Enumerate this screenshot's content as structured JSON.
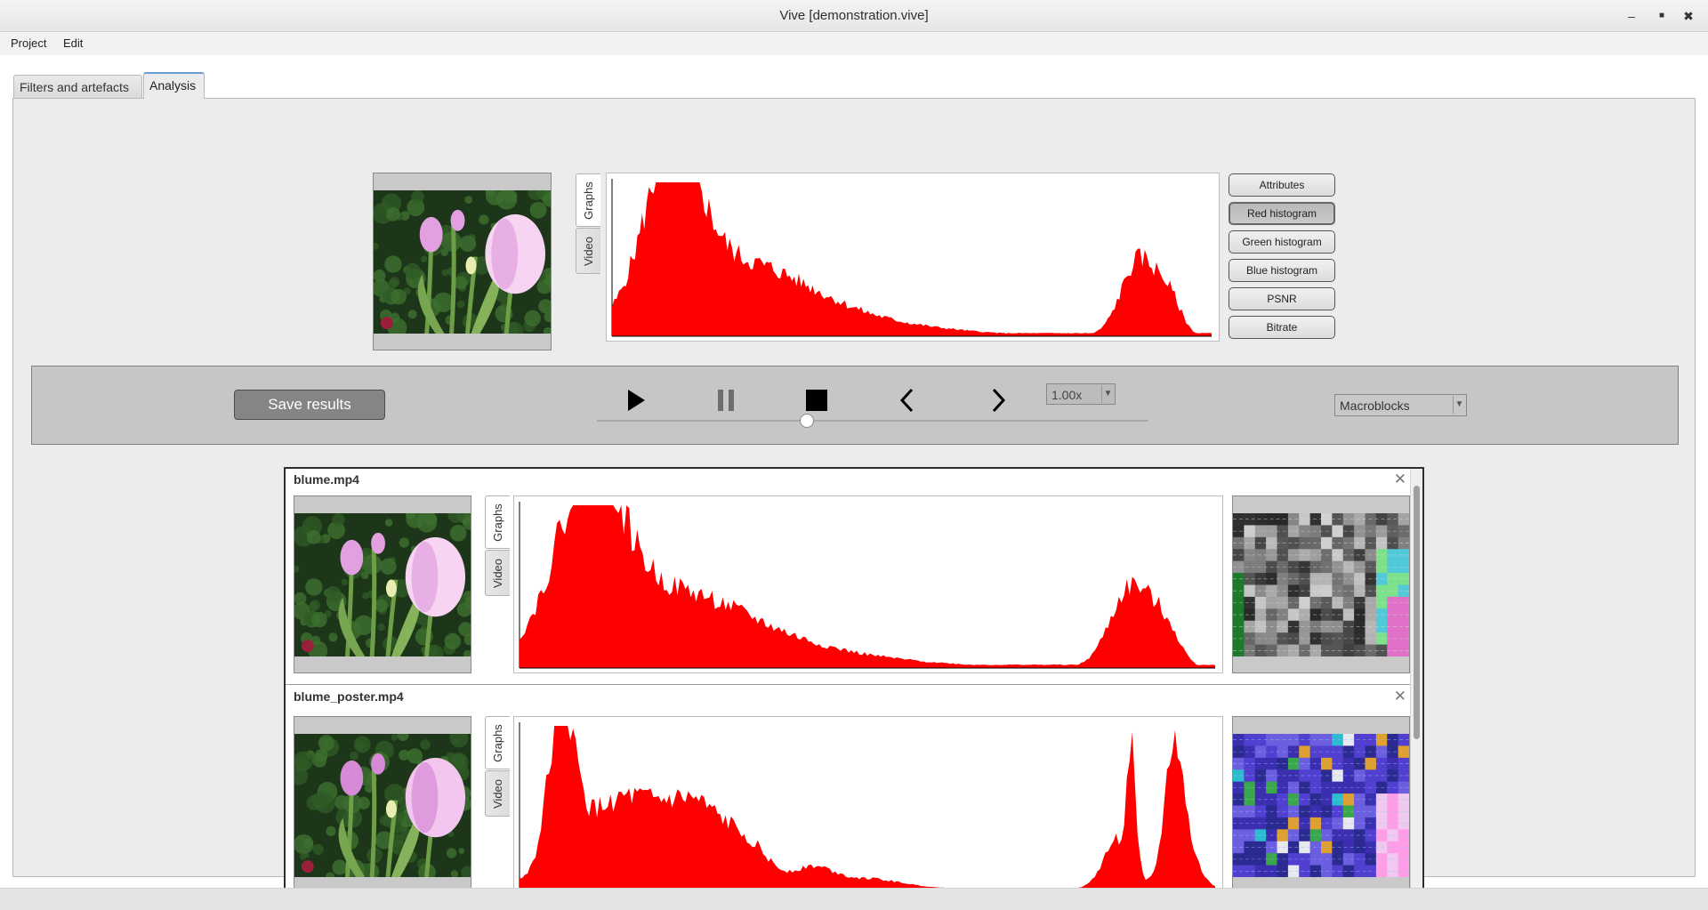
{
  "window": {
    "title": "Vive [demonstration.vive]"
  },
  "menu": {
    "items": [
      "Project",
      "Edit"
    ]
  },
  "tabs": [
    {
      "label": "Filters and artefacts",
      "active": false
    },
    {
      "label": "Analysis",
      "active": true
    }
  ],
  "preview": {
    "side_tabs": [
      "Graphs",
      "Video"
    ],
    "active_side_tab": "Graphs",
    "graph_color": "#ff0000"
  },
  "analysis_buttons": [
    {
      "label": "Attributes",
      "pressed": false
    },
    {
      "label": "Red histogram",
      "pressed": true
    },
    {
      "label": "Green histogram",
      "pressed": false
    },
    {
      "label": "Blue histogram",
      "pressed": false
    },
    {
      "label": "PSNR",
      "pressed": false
    },
    {
      "label": "Bitrate",
      "pressed": false
    }
  ],
  "controls": {
    "save_label": "Save results",
    "icons": [
      "play-icon",
      "pause-icon",
      "stop-icon",
      "previous-frame-icon",
      "next-frame-icon"
    ],
    "speed_value": "1.00x",
    "overlay_value": "Macroblocks",
    "position_fraction": 0.38
  },
  "results": [
    {
      "filename": "blume.mp4",
      "side_tabs": [
        "Graphs",
        "Video"
      ]
    },
    {
      "filename": "blume_poster.mp4",
      "side_tabs": [
        "Graphs",
        "Video"
      ]
    }
  ],
  "close_glyph": "✕"
}
